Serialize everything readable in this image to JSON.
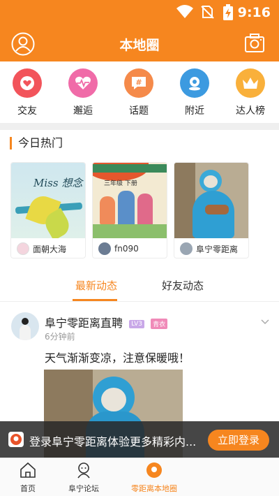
{
  "status_bar": {
    "time": "9:16"
  },
  "header": {
    "title": "本地圈"
  },
  "quick_links": [
    {
      "label": "交友",
      "icon": "heart-icon",
      "color": "#f2545b"
    },
    {
      "label": "邂逅",
      "icon": "heartbeat-icon",
      "color": "#f06ba8"
    },
    {
      "label": "话题",
      "icon": "hashtag-icon",
      "color": "#f58a4a"
    },
    {
      "label": "附近",
      "icon": "location-icon",
      "color": "#3c9ae0"
    },
    {
      "label": "达人榜",
      "icon": "crown-icon",
      "color": "#f9b03b"
    }
  ],
  "hot_today": {
    "title": "今日热门",
    "cards": [
      {
        "user": "面朝大海",
        "art_text": "Miss 想念"
      },
      {
        "user": "fn090",
        "art_text": "三年级 下册"
      },
      {
        "user": "阜宁零距离"
      }
    ]
  },
  "feed_tabs": {
    "active": "最新动态",
    "other": "好友动态"
  },
  "post": {
    "author": "阜宁零距离直聘",
    "level_badge": "LV3",
    "title_badge": "青衣",
    "time": "6分钟前",
    "text": "天气渐渐变凉，注意保暖哦！"
  },
  "login_banner": {
    "text": "登录阜宁零距离体验更多精彩内...",
    "button": "立即登录"
  },
  "bottom_tabs": [
    {
      "label": "首页",
      "icon": "home-icon"
    },
    {
      "label": "阜宁论坛",
      "icon": "forum-icon"
    },
    {
      "label": "零距离本地圈",
      "icon": "local-circle-icon"
    }
  ],
  "colors": {
    "accent": "#f6861f",
    "level_badge": "#c9a8e8",
    "title_badge": "#f08ab8"
  }
}
